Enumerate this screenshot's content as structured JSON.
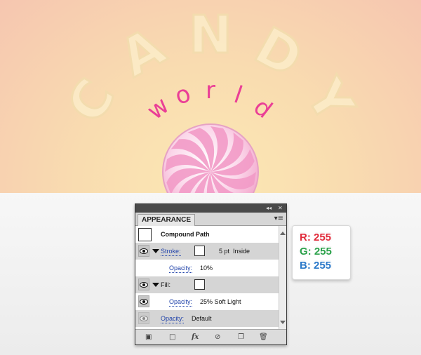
{
  "artwork": {
    "arched_word": "CANDY",
    "script_word": "world",
    "letters_candy": [
      "C",
      "A",
      "N",
      "D",
      "Y"
    ],
    "letters_world": [
      "w",
      "o",
      "r",
      "l",
      "d"
    ],
    "colors": {
      "background_top": "#f6c6b0",
      "background_bottom": "#fbe8b4",
      "text_pink": "#e8409a",
      "candy_pink": "#f4a6cf"
    }
  },
  "panel": {
    "tab_label": "APPEARANCE",
    "collapse_icon": "double-left-arrow-icon",
    "close_icon": "close-icon",
    "menu_icon": "panel-menu-icon",
    "header": {
      "label": "Compound Path"
    },
    "stroke": {
      "label": "Stroke:",
      "value": "5 pt  Inside"
    },
    "stroke_opacity": {
      "label": "Opacity:",
      "value": "10%"
    },
    "fill": {
      "label": "Fill:"
    },
    "fill_opacity": {
      "label": "Opacity:",
      "value": "25% Soft Light"
    },
    "object_opacity": {
      "label": "Opacity:",
      "value": "Default"
    },
    "footer_icons": [
      "add-new-stroke-icon",
      "add-new-fill-icon",
      "add-new-effect-icon",
      "clear-appearance-icon",
      "duplicate-item-icon",
      "delete-item-icon"
    ],
    "fx_label": "fx"
  },
  "rgb_badge": {
    "r": "R: 255",
    "g": "G: 255",
    "b": "B: 255",
    "colors": {
      "r": "#e02a3a",
      "g": "#2ba14a",
      "b": "#2a78c8"
    }
  }
}
